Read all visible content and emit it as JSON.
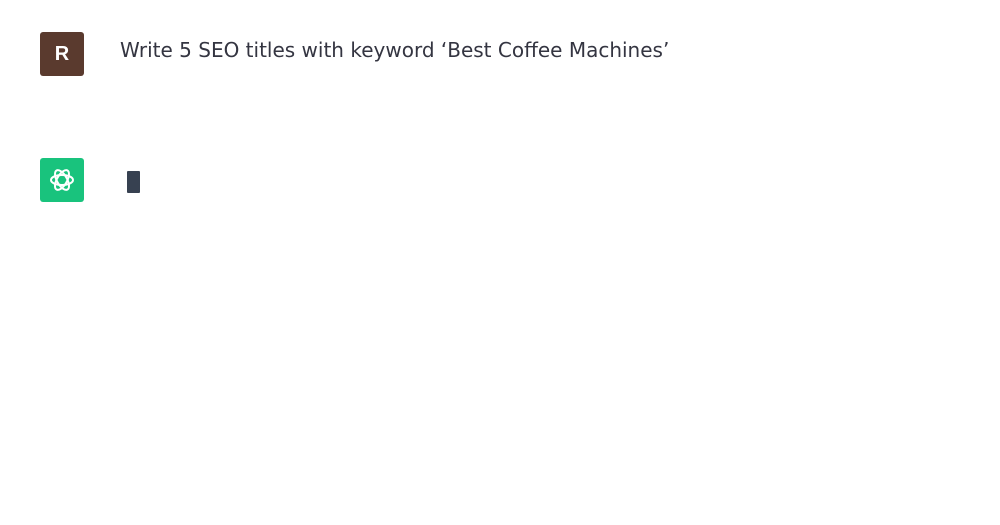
{
  "conversation": {
    "user_message": {
      "avatar_initial": "R",
      "avatar_color": "#5a3a2e",
      "text": "Write 5 SEO titles with keyword ‘Best Coffee Machines’"
    },
    "assistant_message": {
      "avatar_icon": "openai-logo-icon",
      "avatar_color": "#19c37d",
      "status": "typing-cursor"
    }
  }
}
